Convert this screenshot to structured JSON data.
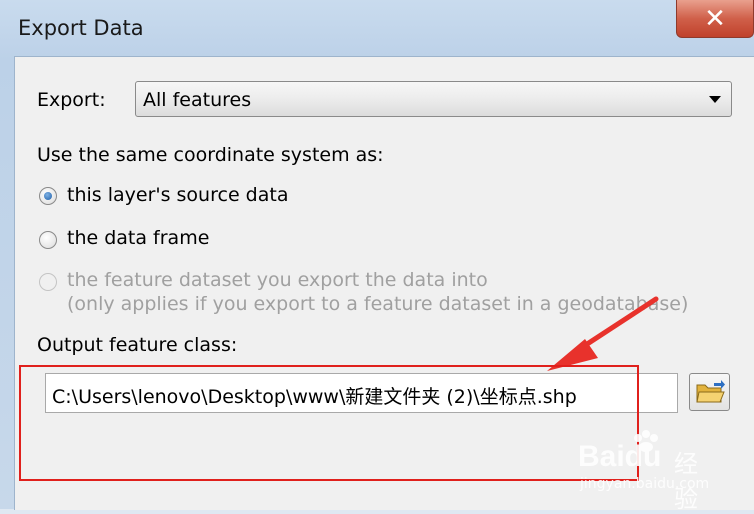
{
  "window": {
    "title": "Export Data",
    "close_glyph": "✕"
  },
  "export": {
    "label": "Export:",
    "selected": "All features"
  },
  "coordinate_system": {
    "heading": "Use the same coordinate system as:",
    "options": [
      {
        "label": "this layer's source data",
        "checked": true,
        "enabled": true
      },
      {
        "label": "the data frame",
        "checked": false,
        "enabled": true
      },
      {
        "label": "the feature dataset you export the data into",
        "note": "(only applies if you export to a feature dataset in a geodatabase)",
        "checked": false,
        "enabled": false
      }
    ]
  },
  "output": {
    "label": "Output feature class:",
    "path": "C:\\Users\\lenovo\\Desktop\\www\\新建文件夹 (2)\\坐标点.shp",
    "browse_icon": "open-folder-icon"
  },
  "annotation": {
    "color": "#e0201c"
  },
  "watermark": {
    "brand": "Baidu",
    "brand_cn": "经验",
    "url": "jingyan.baidu.com"
  }
}
